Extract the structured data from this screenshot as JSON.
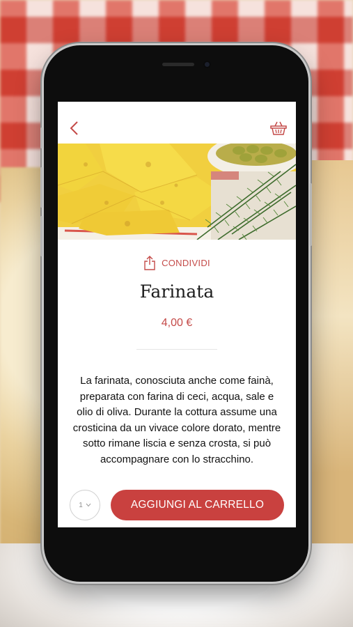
{
  "header": {
    "back_icon": "chevron-left-icon",
    "cart_icon": "basket-icon"
  },
  "product": {
    "image_alt": "farinata-with-rosemary-and-olives",
    "share_label": "CONDIVIDI",
    "name": "Farinata",
    "price": "4,00 €",
    "description": "La farinata, conosciuta anche come fainà, preparata con farina di ceci, acqua, sale e olio di oliva.  Durante la cottura assume una crosticina da un vivace colore dorato, mentre sotto rimane liscia e senza crosta, si può accompagnare con lo stracchino."
  },
  "footer": {
    "quantity": "1",
    "add_to_cart_label": "AGGIUNGI AL CARRELLO"
  },
  "colors": {
    "accent": "#c9413f",
    "text": "#1d1d1d"
  }
}
